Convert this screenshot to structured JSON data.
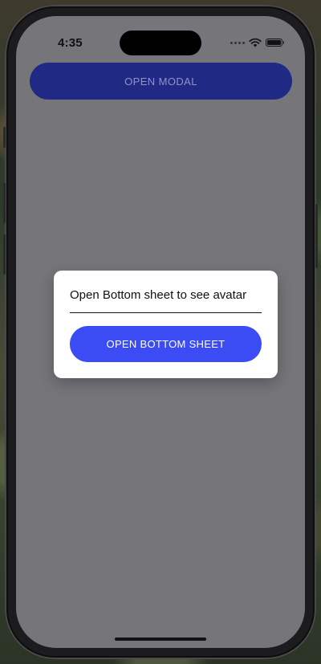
{
  "status_bar": {
    "time": "4:35",
    "icons": [
      "cellular-dots-icon",
      "wifi-icon",
      "battery-icon"
    ]
  },
  "main": {
    "open_modal_label": "OPEN MODAL"
  },
  "modal": {
    "text": "Open Bottom sheet to see avatar",
    "open_bottom_sheet_label": "OPEN BOTTOM SHEET"
  },
  "colors": {
    "overlay": "#76757a",
    "open_modal_button": "#202a85",
    "open_modal_text": "#8f93c6",
    "primary_button": "#3b4cf5",
    "modal_background": "#ffffff"
  }
}
